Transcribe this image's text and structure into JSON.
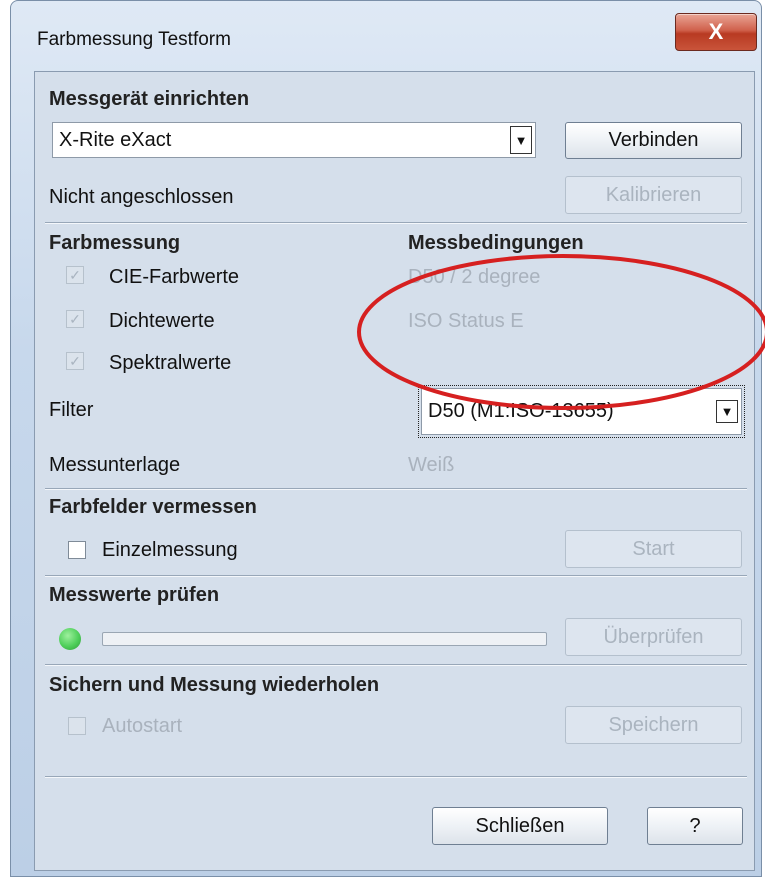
{
  "window": {
    "title": "Farbmessung Testform",
    "close_label": "X"
  },
  "device_setup": {
    "heading": "Messgerät einrichten",
    "device_value": "X-Rite eXact",
    "connect_button": "Verbinden",
    "status": "Nicht angeschlossen",
    "calibrate_button": "Kalibrieren"
  },
  "measurement": {
    "heading": "Farbmessung",
    "conditions_heading": "Messbedingungen",
    "options": [
      {
        "label": "CIE-Farbwerte",
        "checked": true,
        "condition": "D50 / 2 degree"
      },
      {
        "label": "Dichtewerte",
        "checked": true,
        "condition": "ISO Status E"
      },
      {
        "label": "Spektralwerte",
        "checked": true,
        "condition": ""
      }
    ],
    "filter_label": "Filter",
    "filter_value": "D50  (M1:ISO-13655)",
    "backing_label": "Messunterlage",
    "backing_value": "Weiß"
  },
  "fields": {
    "heading": "Farbfelder vermessen",
    "single_label": "Einzelmessung",
    "single_checked": false,
    "start_button": "Start"
  },
  "check_values": {
    "heading": "Messwerte prüfen",
    "progress": 0,
    "verify_button": "Überprüfen"
  },
  "save": {
    "heading": "Sichern und Messung wiederholen",
    "autostart_label": "Autostart",
    "autostart_checked": false,
    "save_button": "Speichern"
  },
  "footer": {
    "close_button": "Schließen",
    "help_button": "?"
  },
  "colors": {
    "annotation": "#d62020",
    "status_led": "#4fcf5a"
  },
  "icons": {
    "check": "✓",
    "dropdown": "▼"
  }
}
